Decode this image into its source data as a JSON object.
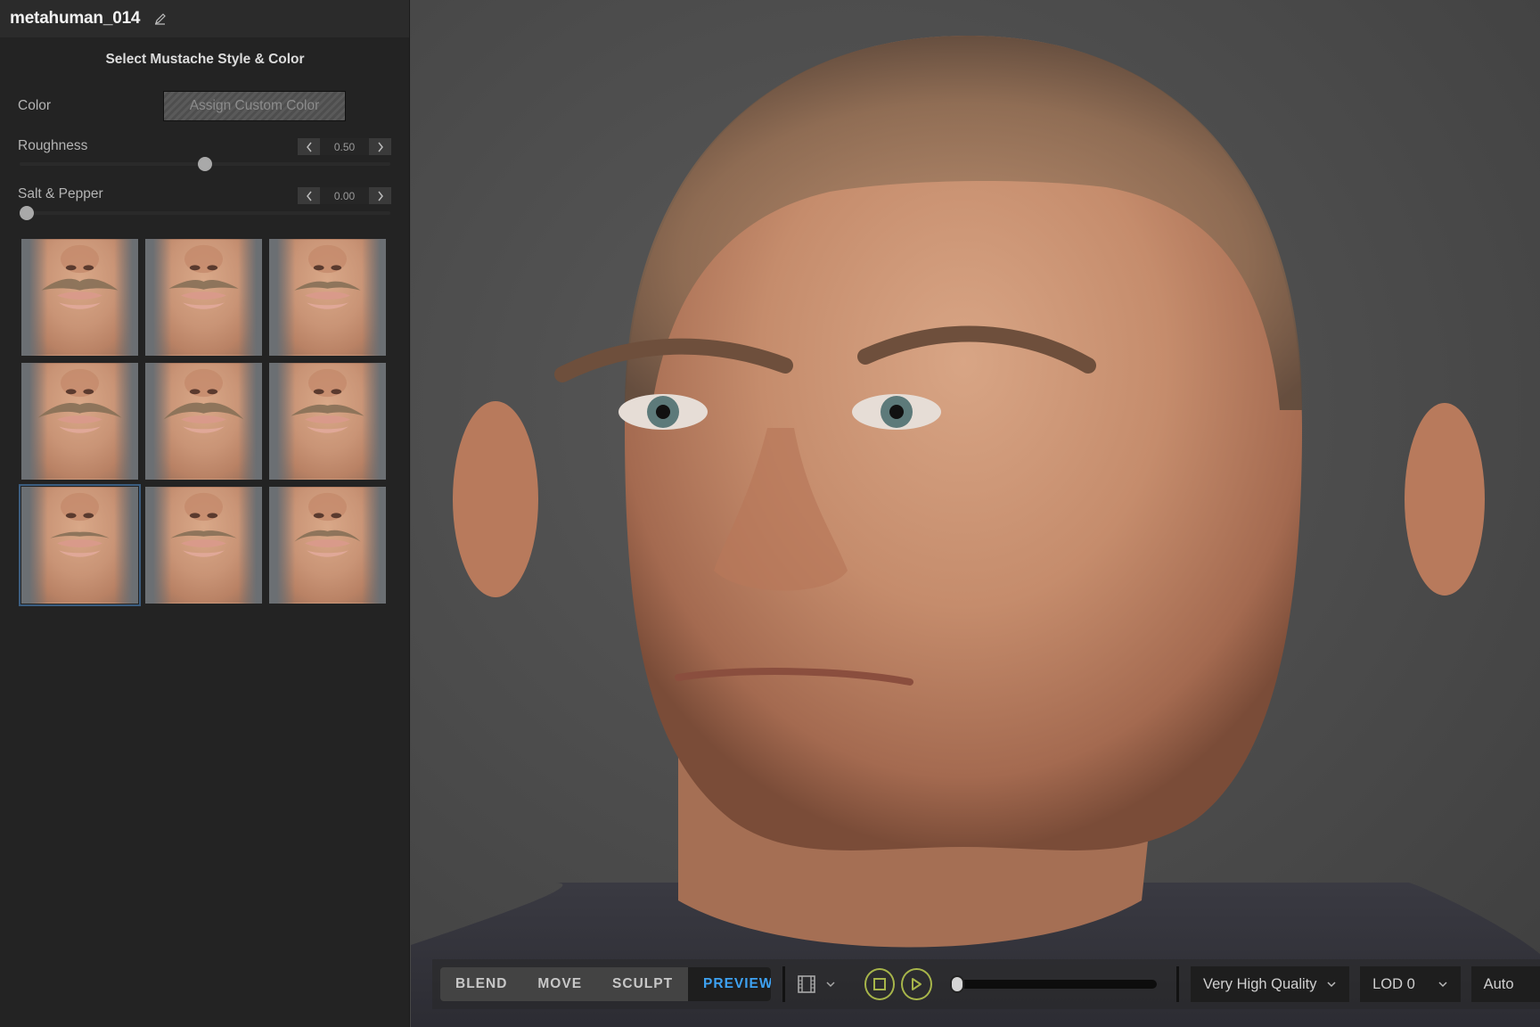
{
  "sidebar": {
    "title": "metahuman_014",
    "section_title": "Select Mustache Style & Color",
    "color": {
      "label": "Color",
      "button_label": "Assign Custom Color"
    },
    "roughness": {
      "label": "Roughness",
      "value": "0.50",
      "fraction": 0.5
    },
    "salt_pepper": {
      "label": "Salt & Pepper",
      "value": "0.00",
      "fraction": 0.0
    },
    "thumbnails": [
      {
        "name": "mustache-style-1",
        "selected": false
      },
      {
        "name": "mustache-style-2",
        "selected": false
      },
      {
        "name": "mustache-style-3",
        "selected": false
      },
      {
        "name": "mustache-style-4",
        "selected": false
      },
      {
        "name": "mustache-style-5",
        "selected": false
      },
      {
        "name": "mustache-style-6",
        "selected": false
      },
      {
        "name": "mustache-style-7",
        "selected": true
      },
      {
        "name": "mustache-style-8",
        "selected": false
      },
      {
        "name": "mustache-style-9",
        "selected": false
      }
    ]
  },
  "toolbar": {
    "modes": [
      "BLEND",
      "MOVE",
      "SCULPT",
      "PREVIEW"
    ],
    "active_mode": "PREVIEW",
    "icons": {
      "camera": "film-strip-icon",
      "stop": "stop-icon",
      "play": "play-icon"
    },
    "timeline_fraction": 0.0,
    "quality": "Very High Quality",
    "lod": "LOD 0",
    "auto": "Auto"
  },
  "colors": {
    "accent_active": "#3ea2f2",
    "playback": "#a7b54a",
    "selected_outline": "#3b5d80"
  }
}
